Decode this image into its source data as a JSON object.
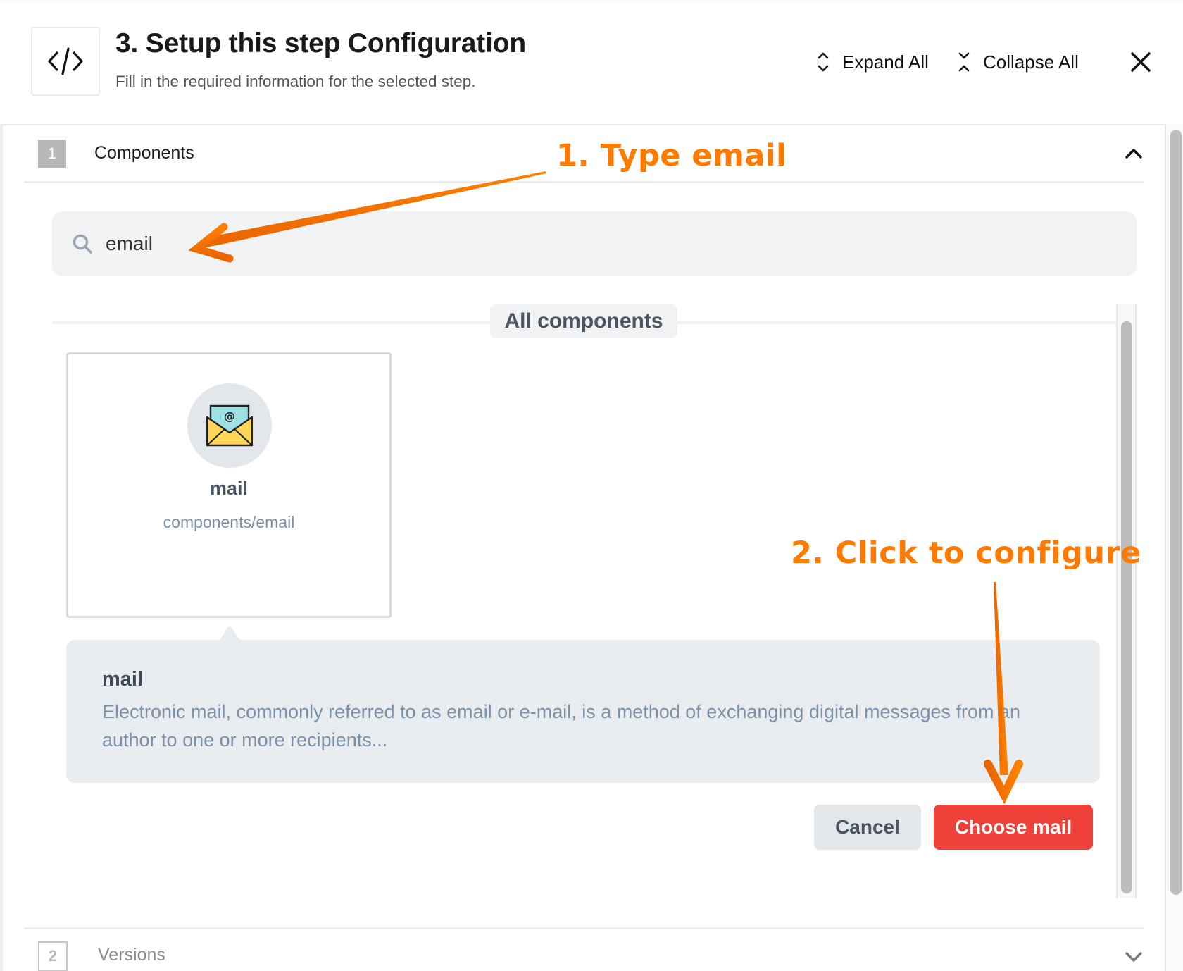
{
  "header": {
    "icon": "code-icon",
    "title": "3. Setup this step Configuration",
    "subtitle": "Fill in the required information for the selected step.",
    "expand_all_label": "Expand All",
    "collapse_all_label": "Collapse All",
    "close_icon": "close-icon"
  },
  "sections": [
    {
      "number": "1",
      "label": "Components",
      "expanded": true,
      "search": {
        "value": "email",
        "icon": "search-icon"
      },
      "group_label": "All components",
      "components": [
        {
          "name": "mail",
          "path": "components/email",
          "icon": "envelope-at-icon",
          "selected": true
        }
      ],
      "description": {
        "title": "mail",
        "text": "Electronic mail, commonly referred to as email or e-mail, is a method of exchanging digital messages from an author to one or more recipients..."
      },
      "actions": {
        "cancel_label": "Cancel",
        "choose_label": "Choose mail"
      }
    },
    {
      "number": "2",
      "label": "Versions",
      "expanded": false
    }
  ],
  "annotations": [
    {
      "text": "1. Type email",
      "color": "#ff7a00"
    },
    {
      "text": "2. Click to configure",
      "color": "#ff7a00"
    }
  ],
  "colors": {
    "primary_button": "#ee4139",
    "annotation": "#ff7a00",
    "muted_text": "#7b91a9"
  }
}
